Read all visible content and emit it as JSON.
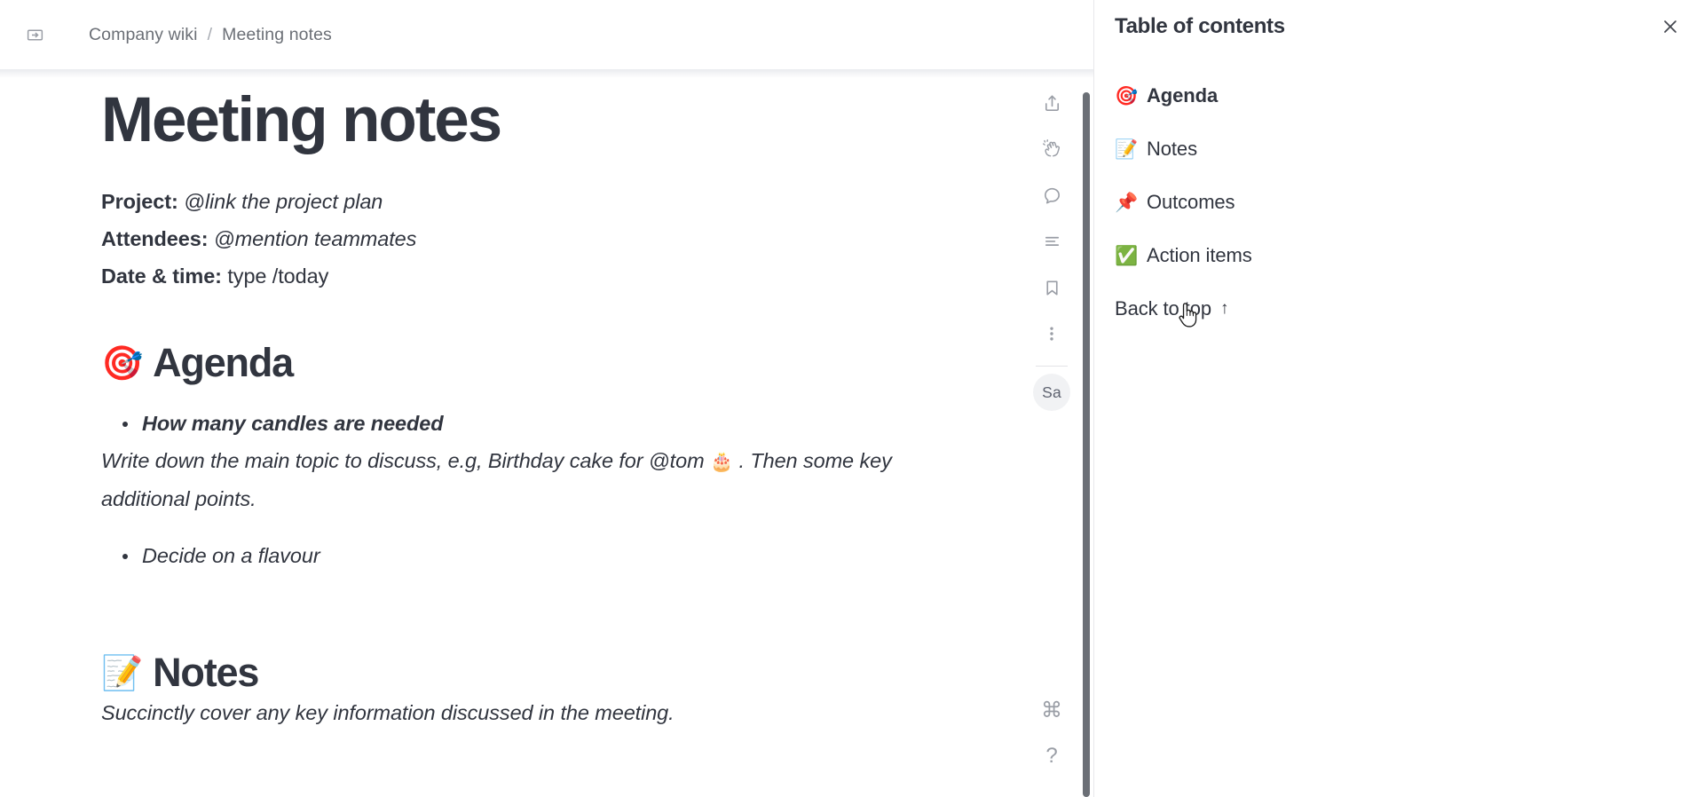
{
  "window": {
    "breadcrumb": {
      "expand_icon": "expand-sidebar-icon",
      "parent": "Company wiki",
      "separator": "/",
      "current": "Meeting notes"
    }
  },
  "document": {
    "title": "Meeting notes",
    "meta": [
      {
        "label": "Project:",
        "value": "@link the project plan",
        "italic": true
      },
      {
        "label": "Attendees:",
        "value": "@mention teammates",
        "italic": true
      },
      {
        "label": "Date & time:",
        "value": "type /today",
        "italic": false
      }
    ],
    "sections": [
      {
        "emoji": "🎯",
        "emoji_name": "direct-hit-icon",
        "heading": "Agenda",
        "bullets_top": [
          {
            "text": "How many candles are needed",
            "strong": true
          }
        ],
        "paragraph": "Write down the main topic to discuss, e.g, Birthday cake for @tom",
        "paragraph_emoji": "🎂",
        "paragraph_emoji_name": "birthday-cake-icon",
        "paragraph_tail": ". Then some key additional points.",
        "bullets_bottom": [
          {
            "text": "Decide on a flavour",
            "strong": false
          }
        ]
      },
      {
        "emoji": "📝",
        "emoji_name": "memo-icon",
        "heading": "Notes",
        "paragraph": "Succinctly cover any key information discussed in the meeting."
      }
    ]
  },
  "rail": {
    "buttons": [
      {
        "name": "share-icon",
        "label": "Share"
      },
      {
        "name": "react-clap-icon",
        "label": "React"
      },
      {
        "name": "comment-icon",
        "label": "Comment"
      },
      {
        "name": "outline-icon",
        "label": "Outline"
      },
      {
        "name": "bookmark-icon",
        "label": "Bookmark"
      },
      {
        "name": "more-options-icon",
        "label": "More actions"
      }
    ],
    "avatar": "Sa",
    "bottom": [
      {
        "name": "command-icon",
        "glyph": "⌘"
      },
      {
        "name": "help-icon",
        "glyph": "?"
      }
    ]
  },
  "toc": {
    "title": "Table of contents",
    "close_icon": "close-icon",
    "items": [
      {
        "emoji": "🎯",
        "emoji_name": "direct-hit-icon",
        "label": "Agenda",
        "active": true
      },
      {
        "emoji": "📝",
        "emoji_name": "memo-icon",
        "label": "Notes",
        "active": false
      },
      {
        "emoji": "📌",
        "emoji_name": "pushpin-icon",
        "label": "Outcomes",
        "active": false
      },
      {
        "emoji": "✅",
        "emoji_name": "check-mark-button-icon",
        "label": "Action items",
        "active": false
      }
    ],
    "back_to_top": "Back to top",
    "back_to_top_arrow": "↑"
  },
  "colors": {
    "text": "#31353f",
    "muted": "#6b6f76",
    "icon": "#9a9ea6",
    "border": "#e8e8ea",
    "scrollbar": "#6b6f76"
  }
}
